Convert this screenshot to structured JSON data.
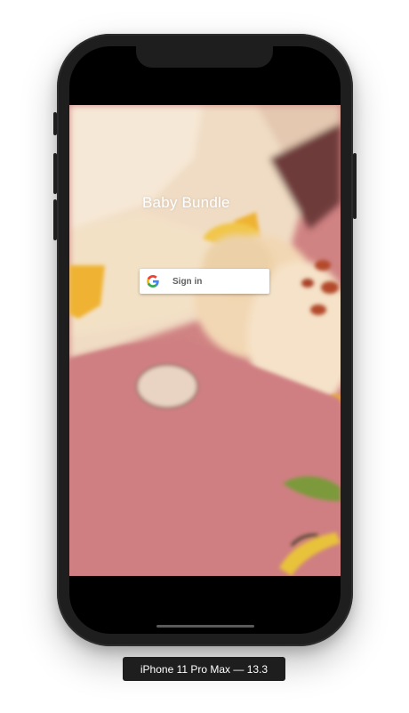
{
  "app": {
    "title": "Baby Bundle"
  },
  "signin_button": {
    "label": "Sign in",
    "icon": "google-g-icon"
  },
  "simulator": {
    "device_label": "iPhone 11 Pro Max — 13.3"
  },
  "colors": {
    "device_frame": "#1e1e1e",
    "signin_background": "#ffffff",
    "signin_text": "#5f5f5f",
    "title_text": "#ffffff"
  }
}
